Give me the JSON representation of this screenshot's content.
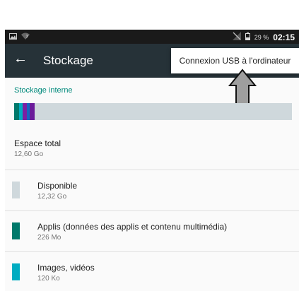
{
  "status": {
    "battery": "29 %",
    "time": "02:15"
  },
  "appbar": {
    "title": "Stockage",
    "back_icon": "arrow-left-icon"
  },
  "menu": {
    "item": "Connexion USB à l'ordinateur"
  },
  "storage": {
    "section_label": "Stockage interne",
    "bar_segments": [
      {
        "color": "#00796b",
        "fraction": 0.018
      },
      {
        "color": "#00acc1",
        "fraction": 0.012
      },
      {
        "color": "#7b1fa2",
        "fraction": 0.015
      },
      {
        "color": "#1565c0",
        "fraction": 0.012
      },
      {
        "color": "#6a1b9a",
        "fraction": 0.018
      }
    ],
    "bar_empty_color": "#cfd8dc",
    "total": {
      "label": "Espace total",
      "value": "12,60 Go"
    },
    "items": [
      {
        "label": "Disponible",
        "value": "12,32 Go",
        "color": "#cfd8dc"
      },
      {
        "label": "Applis (données des applis et contenu multimédia)",
        "value": "226 Mo",
        "color": "#00796b"
      },
      {
        "label": "Images, vidéos",
        "value": "120 Ko",
        "color": "#00acc1"
      }
    ]
  }
}
